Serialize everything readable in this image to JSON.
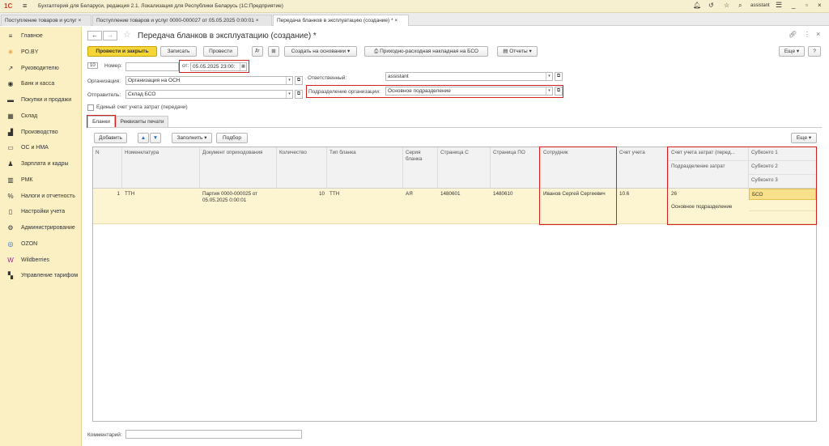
{
  "app": {
    "title": "Бухгалтерия для Беларуси, редакция 2.1. Локализация для Республики Беларусь  (1С:Предприятие)",
    "user": "assistant"
  },
  "tabs": [
    {
      "label": "Поступление товаров и услуг"
    },
    {
      "label": "Поступление товаров и услуг 0000-000027 от 05.05.2025 0:00:01"
    },
    {
      "label": "Передача бланков в эксплуатацию (создание) *"
    }
  ],
  "sidebar": {
    "items": [
      {
        "label": "Главное",
        "icon": "menu-icon"
      },
      {
        "label": "PO.BY",
        "icon": "star-icon"
      },
      {
        "label": "Руководителю",
        "icon": "chart-icon"
      },
      {
        "label": "Банк и касса",
        "icon": "bank-icon"
      },
      {
        "label": "Покупки и продажи",
        "icon": "cart-icon"
      },
      {
        "label": "Склад",
        "icon": "warehouse-icon"
      },
      {
        "label": "Производство",
        "icon": "factory-icon"
      },
      {
        "label": "ОС и НМА",
        "icon": "truck-icon"
      },
      {
        "label": "Зарплата и кадры",
        "icon": "people-icon"
      },
      {
        "label": "РМК",
        "icon": "register-icon"
      },
      {
        "label": "Налоги и отчетность",
        "icon": "percent-icon"
      },
      {
        "label": "Настройки учета",
        "icon": "settings-icon"
      },
      {
        "label": "Администрирование",
        "icon": "gear-icon"
      },
      {
        "label": "OZON",
        "icon": "ozon-icon"
      },
      {
        "label": "Wildberries",
        "icon": "wb-icon"
      },
      {
        "label": "Управление тарифом",
        "icon": "tariff-icon"
      }
    ]
  },
  "form": {
    "title": "Передача бланков в эксплуатацию (создание) *",
    "toolbar": {
      "post_close": "Провести и закрыть",
      "save": "Записать",
      "post": "Провести",
      "create_based": "Создать на основании",
      "invoice": "Приходно-расходная накладная на БСО",
      "reports": "Отчеты",
      "more": "Еще",
      "help": "?"
    },
    "number_label": "Номер:",
    "number_value": "",
    "date_label": "от:",
    "date_value": "05.05.2025 23:00:",
    "org_label": "Организация:",
    "org_value": "Организация на ОСН",
    "sender_label": "Отправитель:",
    "sender_value": "Склад БСО",
    "resp_label": "Ответственный:",
    "resp_value": "assistant",
    "dept_label": "Подразделение организации:",
    "dept_value": "Основное подразделение",
    "single_account_label": "Единый счет учета затрат (передачи)",
    "subtabs": [
      "Бланки",
      "Реквизиты печати"
    ],
    "table_toolbar": {
      "add": "Добавить",
      "fill": "Заполнить",
      "select": "Подбор",
      "more": "Еще"
    },
    "columns": {
      "n": "N",
      "item": "Номенклатура",
      "doc": "Документ оприходования",
      "qty": "Количество",
      "type": "Тип бланка",
      "series": "Серия бланка",
      "page_from": "Страница С",
      "page_to": "Страница ПО",
      "employee": "Сотрудник",
      "account": "Счет учета",
      "cost_account": "Счет учета затрат (перед...",
      "cost_dept": "Подразделение затрат",
      "sub1": "Субконто 1",
      "sub2": "Субконто 2",
      "sub3": "Субконто 3"
    },
    "rows": [
      {
        "n": "1",
        "item": "ТТН",
        "doc": "Партия 0000-000025 от 05.05.2025 0:00:01",
        "qty": "10",
        "type": "ТТН",
        "series": "АЯ",
        "page_from": "1480601",
        "page_to": "1480610",
        "employee": "Иванов Сергей Сергеевич",
        "account": "10.6",
        "cost_account": "26",
        "cost_dept": "Основное подразделение",
        "sub1": "БСО",
        "sub2": "",
        "sub3": ""
      }
    ],
    "comment_label": "Комментарий:",
    "comment_value": ""
  }
}
